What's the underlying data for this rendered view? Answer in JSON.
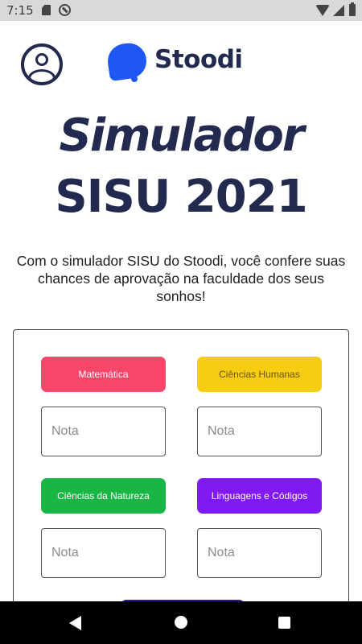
{
  "status_bar": {
    "time": "7:15",
    "icons": [
      "sim-card-icon",
      "data-saver-icon",
      "wifi-icon",
      "signal-icon",
      "battery-icon"
    ]
  },
  "header": {
    "logo_text": "Stoodi",
    "brand_color": "#1f57f5",
    "profile_icon": "account-circle-icon"
  },
  "hero": {
    "title_line1": "Simulador",
    "title_line2": "SISU 2021",
    "description": "Com o simulador SISU do Stoodi, você confere suas chances de aprovação na faculdade dos seus sonhos!",
    "title_color": "#232a4f"
  },
  "form": {
    "subjects": [
      {
        "label": "Matemática",
        "color": "#f6476a",
        "placeholder": "Nota"
      },
      {
        "label": "Ciências Humanas",
        "color": "#f6cd12",
        "placeholder": "Nota"
      },
      {
        "label": "Ciências da Natureza",
        "color": "#1ab645",
        "placeholder": "Nota"
      },
      {
        "label": "Linguagens e Códigos",
        "color": "#8019f2",
        "placeholder": "Nota"
      }
    ],
    "submit_color": "#3c0d8f"
  },
  "nav_bar": {
    "icons": [
      "back-icon",
      "home-icon",
      "recents-icon"
    ]
  }
}
